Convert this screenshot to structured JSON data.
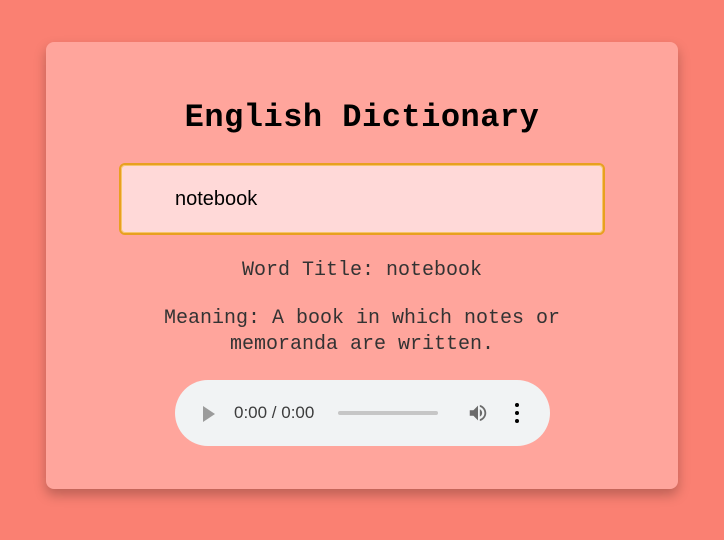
{
  "app": {
    "title": "English Dictionary"
  },
  "search": {
    "value": "notebook",
    "placeholder": ""
  },
  "result": {
    "word_title": "Word Title: notebook",
    "meaning": "Meaning: A book in which notes or memoranda are written."
  },
  "audio_player": {
    "time": "0:00 / 0:00",
    "progress": 0,
    "icons": [
      "play-icon",
      "volume-icon",
      "more-options-icon"
    ]
  },
  "colors": {
    "page_background": "#fa8072",
    "card_background": "#ffa59c",
    "input_background": "#ffd9d8",
    "input_border": "#e8a020",
    "player_background": "#f1f3f4"
  }
}
